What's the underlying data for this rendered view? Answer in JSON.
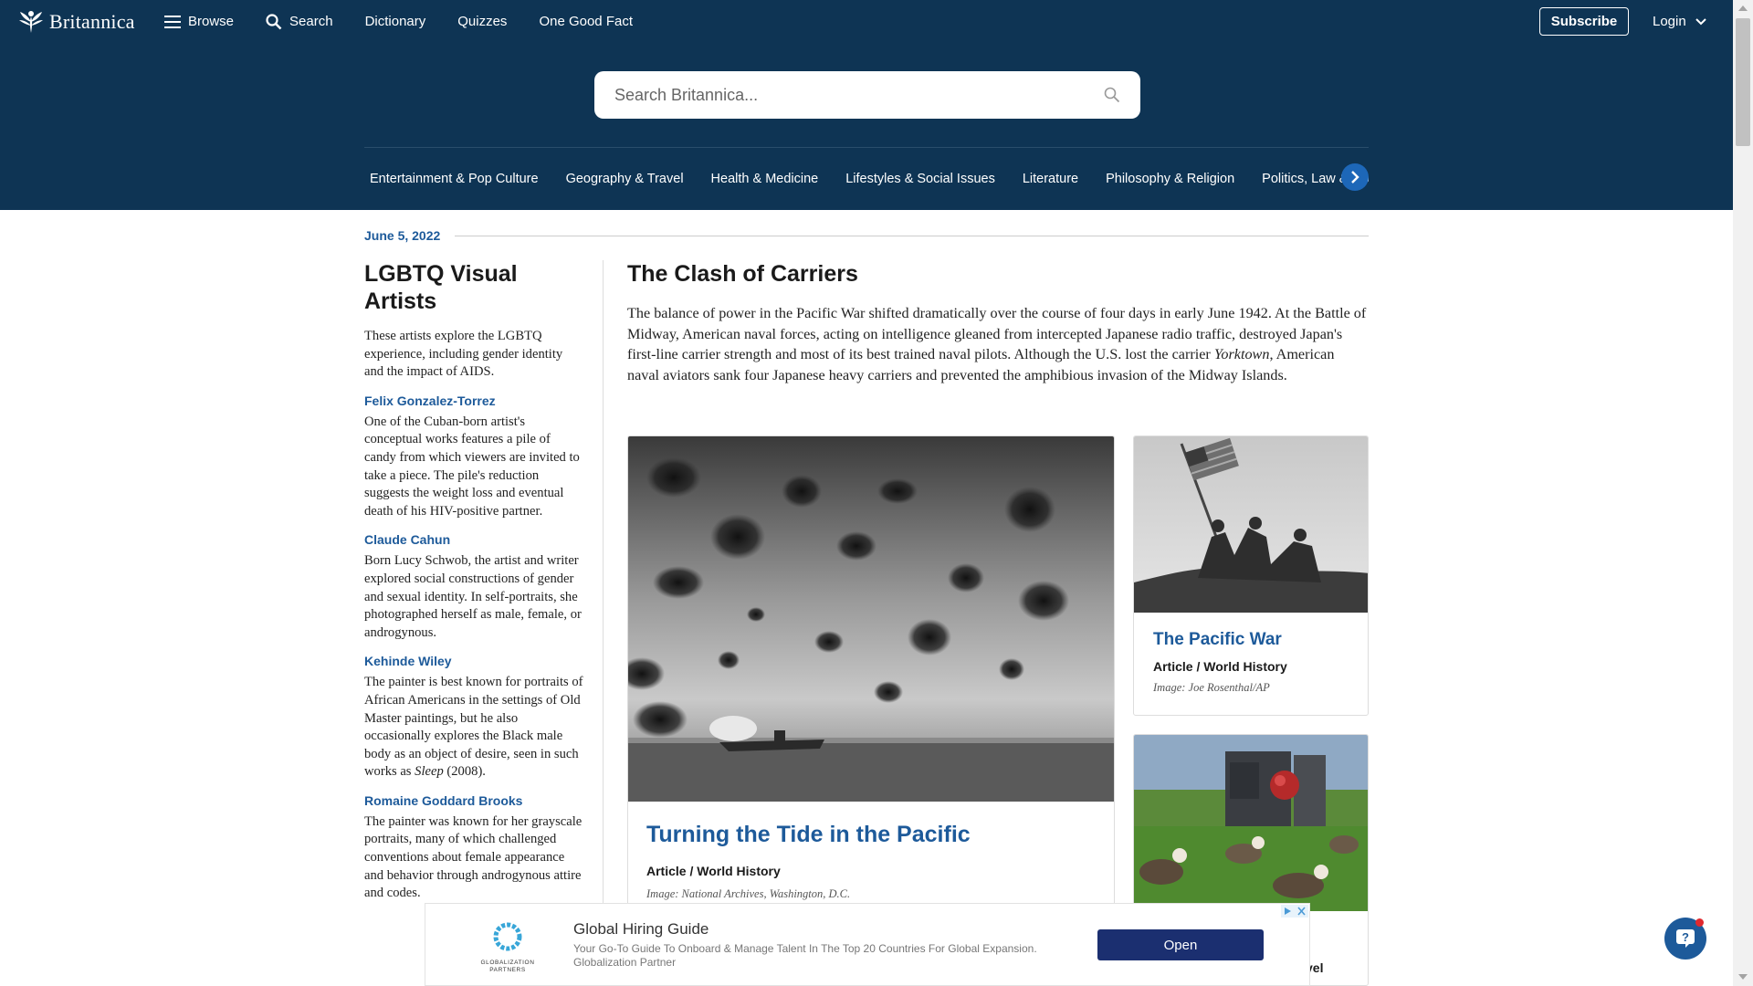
{
  "nav": {
    "logo_text": "Britannica",
    "links": [
      {
        "label": "Browse",
        "icon": "menu-icon"
      },
      {
        "label": "Search",
        "icon": "search-icon"
      },
      {
        "label": "Dictionary"
      },
      {
        "label": "Quizzes"
      },
      {
        "label": "One Good Fact"
      }
    ],
    "subscribe_label": "Subscribe",
    "login_label": "Login"
  },
  "search": {
    "placeholder": "Search Britannica..."
  },
  "categories": [
    "Entertainment & Pop Culture",
    "Geography & Travel",
    "Health & Medicine",
    "Lifestyles & Social Issues",
    "Literature",
    "Philosophy & Religion",
    "Politics, Law & Government"
  ],
  "date": "June 5, 2022",
  "left": {
    "title": "LGBTQ Visual Artists",
    "intro": "These artists explore the LGBTQ experience, including gender identity and the impact of AIDS.",
    "artists": [
      {
        "name": "Felix Gonzalez-Torrez",
        "desc": "One of the Cuban-born artist's conceptual works features a pile of candy from which viewers are invited to take a piece. The pile's reduction suggests the weight loss and eventual death of his HIV-positive partner."
      },
      {
        "name": "Claude Cahun",
        "desc": "Born Lucy Schwob, the artist and writer explored social constructions of gender and sexual identity. In self-portraits, she photographed herself as male, female, or androgynous."
      },
      {
        "name": "Kehinde Wiley",
        "desc_before": "The painter is best known for portraits of African Americans in the settings of Old Master paintings, but he also occasionally explores the Black male body as an object of desire, seen in such works as ",
        "desc_em": "Sleep",
        "desc_after": " (2008)."
      },
      {
        "name": "Romaine Goddard Brooks",
        "desc": "The painter was known for her grayscale portraits, many of which challenged conventions about female appearance and behavior through androgynous attire and codes."
      }
    ]
  },
  "main": {
    "title": "The Clash of Carriers",
    "body_before": "The balance of power in the Pacific War shifted dramatically over the course of four days in early June 1942. At the Battle of Midway, American naval forces, acting on intelligence gleaned from intercepted Japanese radio traffic, destroyed Japan's first-line carrier strength and most of its best trained naval pilots. Although the U.S. lost the carrier ",
    "body_em": "Yorktown",
    "body_after": ", American naval aviators sank four Japanese heavy carriers and prevented the amphibious invasion of the Midway Islands."
  },
  "cards": {
    "big": {
      "title": "Turning the Tide in the Pacific",
      "meta": "Article / World History",
      "credit": "Image: National Archives, Washington, D.C."
    },
    "small1": {
      "title": "The Pacific War",
      "meta": "Article / World History",
      "credit": "Image: Joe Rosenthal/AP"
    },
    "small2": {
      "meta_partial": "vel"
    }
  },
  "ad": {
    "logo_text": "GLOBALIZATION PARTNERS",
    "title": "Global Hiring Guide",
    "desc": "Your Go-To Guide To Onboard & Manage Talent In The Top 20 Countries For Global Expansion. Globalization Partner",
    "button": "Open"
  },
  "colors": {
    "nav_bg": "#0e3454",
    "link_blue": "#1d5a9a",
    "ad_button": "#1b2f70",
    "fab": "#1d5a9a"
  }
}
